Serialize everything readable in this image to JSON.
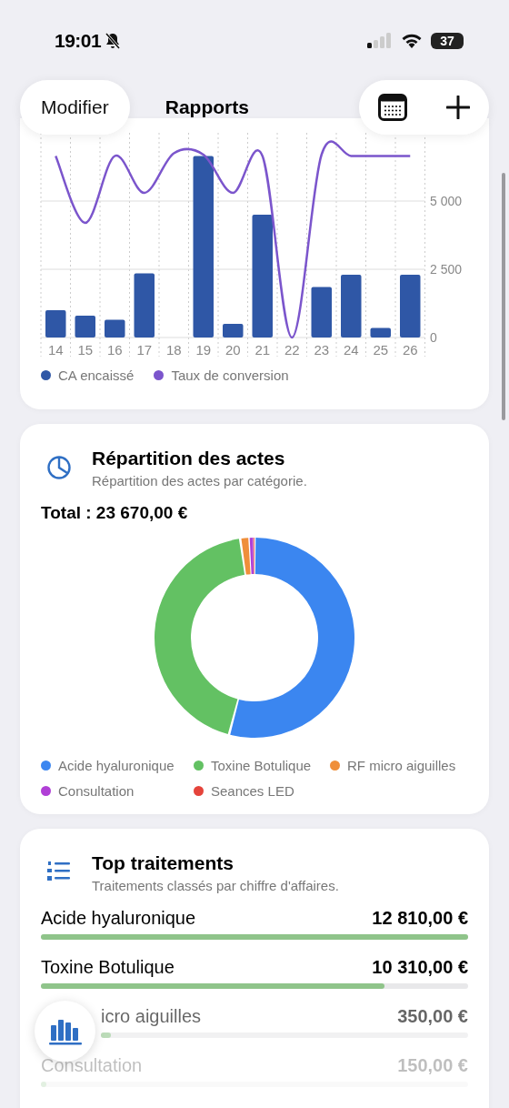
{
  "status_bar": {
    "time": "19:01",
    "battery": "37"
  },
  "nav": {
    "left_button": "Modifier",
    "title": "Rapports"
  },
  "revenue_card": {
    "chart_data": {
      "type": "bar",
      "categories": [
        "14",
        "15",
        "16",
        "17",
        "18",
        "19",
        "20",
        "21",
        "22",
        "23",
        "24",
        "25",
        "26"
      ],
      "ylim": [
        0,
        7500
      ],
      "yticks": [
        {
          "value": 0,
          "label": "0"
        },
        {
          "value": 2500,
          "label": "2 500"
        },
        {
          "value": 5000,
          "label": "5 000"
        }
      ],
      "series": [
        {
          "name": "CA encaissé",
          "color": "#2f57a6",
          "values": [
            1000,
            800,
            650,
            2350,
            0,
            6650,
            500,
            4500,
            0,
            1850,
            2300,
            350,
            2300
          ]
        },
        {
          "name": "Taux de conversion",
          "color": "#7b55cc",
          "type": "line",
          "values": [
            6650,
            4200,
            6650,
            5300,
            6750,
            6700,
            5300,
            6650,
            0,
            6700,
            6650,
            6650,
            6650
          ]
        }
      ]
    }
  },
  "breakdown_card": {
    "title": "Répartition des actes",
    "subtitle": "Répartition des actes par catégorie.",
    "total": "Total : 23 670,00 €",
    "chart_data": {
      "type": "donut",
      "categories": [
        "Acide hyaluronique",
        "Toxine Botulique",
        "RF micro aiguilles",
        "Consultation",
        "Seances LED"
      ],
      "values": [
        54.1,
        43.6,
        1.5,
        0.6,
        0.2
      ],
      "colors": [
        "#3b86f0",
        "#63c163",
        "#ef8f3a",
        "#b03fd6",
        "#e5443b"
      ]
    }
  },
  "top_card": {
    "title": "Top traitements",
    "subtitle": "Traitements classés par chiffre d'affaires.",
    "rows": [
      {
        "name": "Acide hyaluronique",
        "amount": "12 810,00 €",
        "level": 1
      },
      {
        "name": "Toxine Botulique",
        "amount": "10 310,00 €",
        "level": 0.805
      },
      {
        "name": "icro aiguilles",
        "amount": "350,00 €",
        "level": 0.027
      },
      {
        "name": "Consultation",
        "amount": "150,00 €",
        "level": 0.012
      }
    ]
  }
}
